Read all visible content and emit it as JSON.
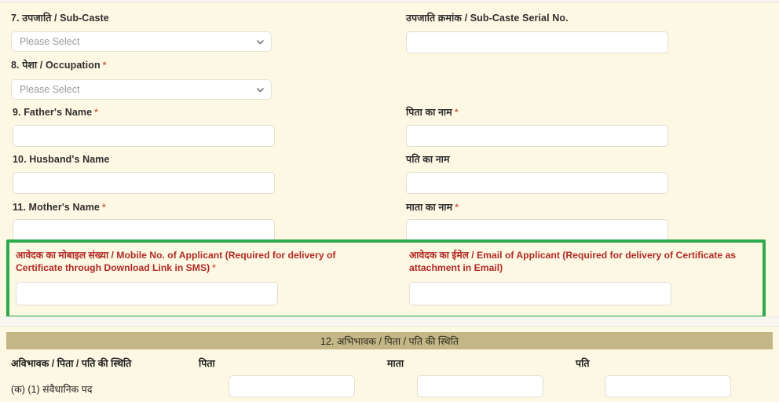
{
  "section1": {
    "fields": [
      {
        "id": "sub-caste",
        "label_number": "7.",
        "label_hi": "उपजाति",
        "label_en": "Sub-Caste",
        "label": "7. उपजाति / Sub-Caste",
        "required": false,
        "control": "select",
        "placeholder": "Please Select",
        "value": "",
        "column": "left"
      },
      {
        "id": "sub-caste-serial-no",
        "label_hi": "उपजाति क्रमांक",
        "label_en": "Sub-Caste Serial No.",
        "label": "उपजाति क्रमांक / Sub-Caste Serial No.",
        "required": false,
        "control": "text",
        "value": "",
        "column": "right"
      },
      {
        "id": "occupation",
        "label_number": "8.",
        "label_hi": "पेशा",
        "label_en": "Occupation",
        "label": "8. पेशा / Occupation",
        "required": true,
        "control": "select",
        "placeholder": "Please Select",
        "value": "",
        "column": "left"
      },
      {
        "id": "fathers-name",
        "label": "9. Father's Name",
        "required": true,
        "control": "text",
        "value": "",
        "column": "left"
      },
      {
        "id": "fathers-name-hi",
        "label": "पिता का नाम",
        "required": true,
        "control": "text",
        "value": "",
        "column": "right"
      },
      {
        "id": "husbands-name",
        "label": "10. Husband's Name",
        "required": false,
        "control": "text",
        "value": "",
        "column": "left"
      },
      {
        "id": "husbands-name-hi",
        "label": "पति का नाम",
        "required": false,
        "control": "text",
        "value": "",
        "column": "right"
      },
      {
        "id": "mothers-name",
        "label": "11. Mother's Name",
        "required": true,
        "control": "text",
        "value": "",
        "column": "left"
      },
      {
        "id": "mothers-name-hi",
        "label": "माता का नाम",
        "required": true,
        "control": "text",
        "value": "",
        "column": "right"
      }
    ]
  },
  "highlight": {
    "border_color": "#2eaa4e",
    "mobile": {
      "label_line1": "आवेदक का मोबाइल संख्या / Mobile No. of Applicant (Required for delivery of Certificate",
      "label_line2": "through Download Link in SMS)",
      "required": true,
      "value": ""
    },
    "email": {
      "label_line1": "आवेदक का ईमेल / Email of Applicant (Required for delivery of Certificate as attachment in",
      "label_line2": "Email)",
      "required": false,
      "value": ""
    }
  },
  "section2": {
    "bar_title": "12. अभिभावक / पिता / पति की स्थिति",
    "bar_color": "#c3b787",
    "headers": [
      "अविभावक / पिता / पति की स्थिति",
      "पिता",
      "माता",
      "पति"
    ],
    "rows": [
      {
        "label": "(क) (1) संवैधानिक पद",
        "values": [
          "",
          "",
          ""
        ]
      }
    ]
  },
  "icons": {
    "chevron_down": "chevron-down-icon"
  },
  "colors": {
    "page_background": "#fdf8e3",
    "field_background": "#ffffff",
    "field_border": "#e2ded0",
    "label_text": "#2e2e2e",
    "required_mark": "#d0654a",
    "highlight_label_text": "#b02a26",
    "highlight_border": "#2eaa4e",
    "section_bar": "#c3b787"
  },
  "required_mark": "*"
}
